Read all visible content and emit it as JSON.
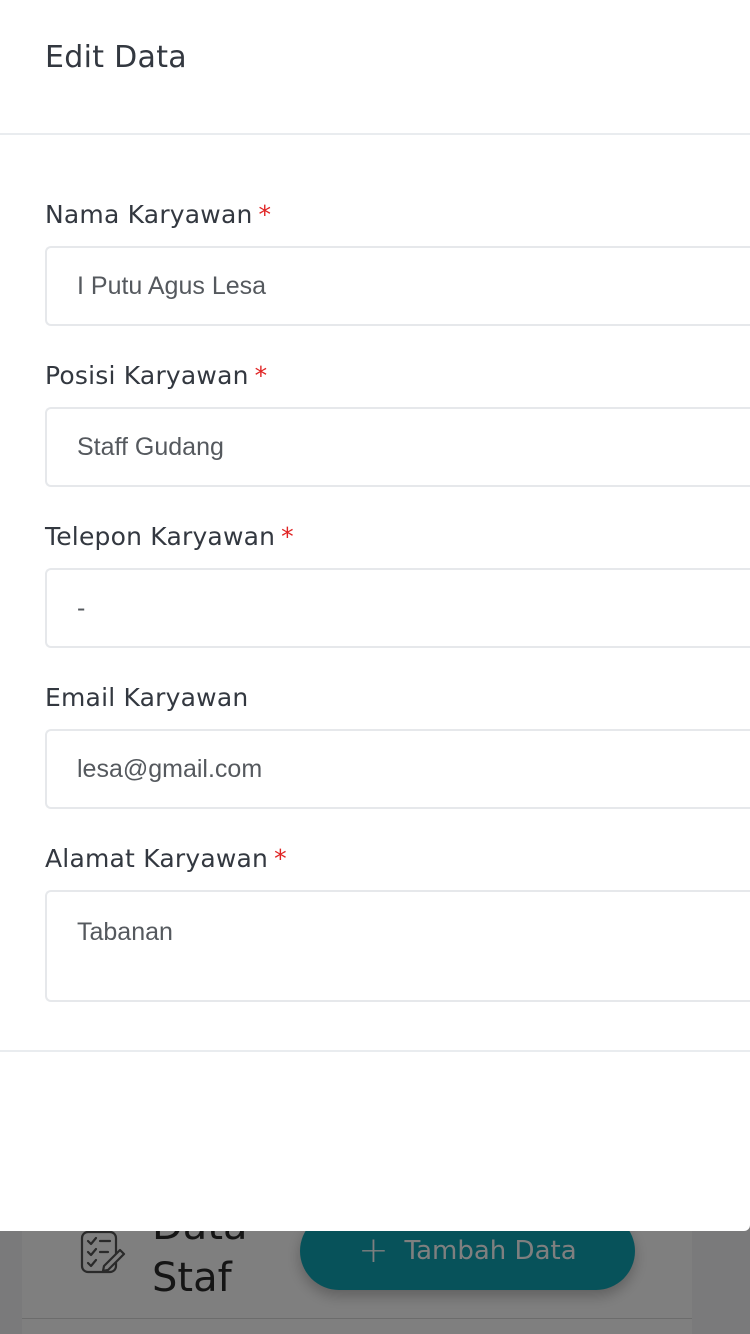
{
  "background": {
    "title_line1": "Data",
    "title_line2": "Staf",
    "add_button_label": "Tambah Data",
    "add_button_icon": "plus-icon",
    "list_icon": "checklist-edit-icon",
    "accent_color": "#0ea5b5"
  },
  "modal": {
    "title": "Edit Data",
    "fields": [
      {
        "label": "Nama Karyawan",
        "required": true,
        "value": "I Putu Agus Lesa"
      },
      {
        "label": "Posisi Karyawan",
        "required": true,
        "value": "Staff Gudang"
      },
      {
        "label": "Telepon Karyawan",
        "required": true,
        "value": "-"
      },
      {
        "label": "Email Karyawan",
        "required": false,
        "value": "lesa@gmail.com"
      },
      {
        "label": "Alamat Karyawan",
        "required": true,
        "value": "Tabanan"
      }
    ],
    "required_marker": "*"
  }
}
